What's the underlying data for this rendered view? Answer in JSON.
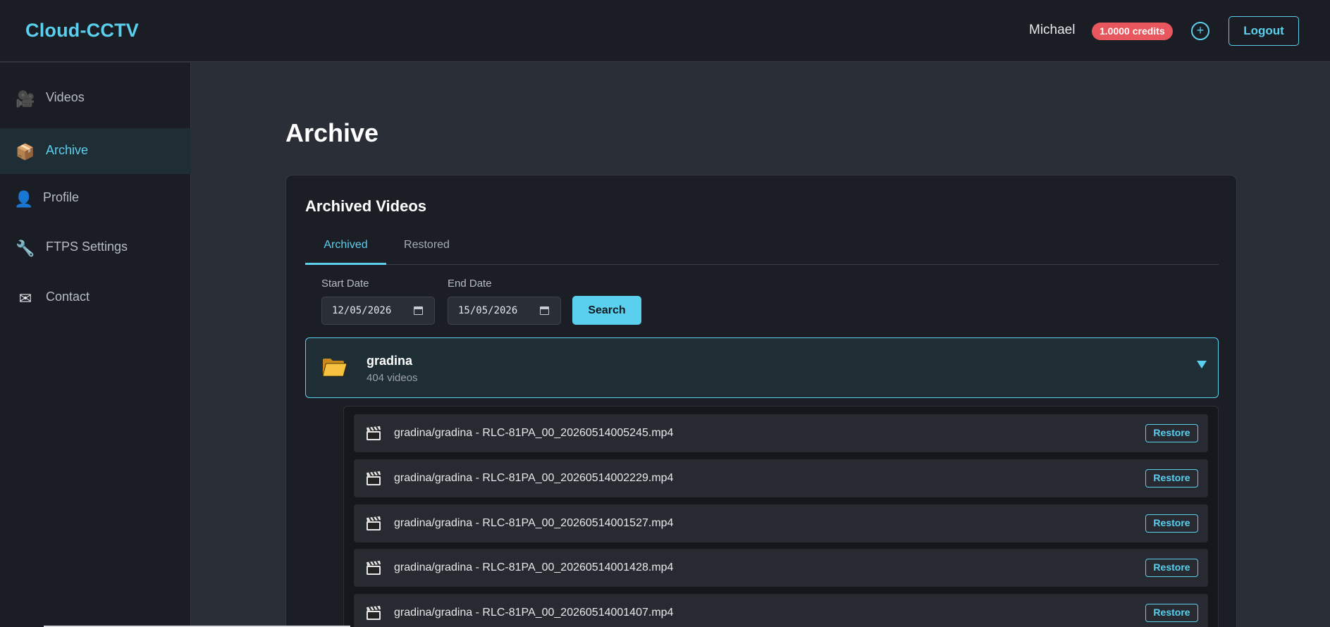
{
  "header": {
    "brand": "Cloud-CCTV",
    "user": "Michael",
    "credits": "1.0000 credits",
    "add_label": "+",
    "logout_label": "Logout"
  },
  "sidebar": {
    "items": [
      {
        "label": "Videos",
        "icon": "video-camera-icon",
        "glyph": "🎥",
        "active": false
      },
      {
        "label": "Archive",
        "icon": "box-icon",
        "glyph": "📦",
        "active": true
      },
      {
        "label": "Profile",
        "icon": "profile-icon",
        "glyph": "👤",
        "active": false
      },
      {
        "label": "FTPS Settings",
        "icon": "wrench-icon",
        "glyph": "🔧",
        "active": false
      },
      {
        "label": "Contact",
        "icon": "envelope-icon",
        "glyph": "✉",
        "active": false
      }
    ]
  },
  "main": {
    "title": "Archive",
    "card_title": "Archived Videos",
    "tabs": [
      {
        "label": "Archived",
        "active": true
      },
      {
        "label": "Restored",
        "active": false
      }
    ],
    "filters": {
      "start_label": "Start Date",
      "start_value": "12/05/2026",
      "end_label": "End Date",
      "end_value": "15/05/2026",
      "search_label": "Search"
    },
    "folder": {
      "name": "gradina",
      "count": "404 videos",
      "icon": "folder-icon"
    },
    "videos": [
      {
        "name": "gradina/gradina - RLC-81PA_00_20260514005245.mp4",
        "action": "Restore"
      },
      {
        "name": "gradina/gradina - RLC-81PA_00_20260514002229.mp4",
        "action": "Restore"
      },
      {
        "name": "gradina/gradina - RLC-81PA_00_20260514001527.mp4",
        "action": "Restore"
      },
      {
        "name": "gradina/gradina - RLC-81PA_00_20260514001428.mp4",
        "action": "Restore"
      },
      {
        "name": "gradina/gradina - RLC-81PA_00_20260514001407.mp4",
        "action": "Restore"
      }
    ]
  },
  "colors": {
    "accent": "#5ad0ee",
    "credits_badge": "#e7575d",
    "background": "#2a2e37",
    "panel": "#1b1e24"
  }
}
